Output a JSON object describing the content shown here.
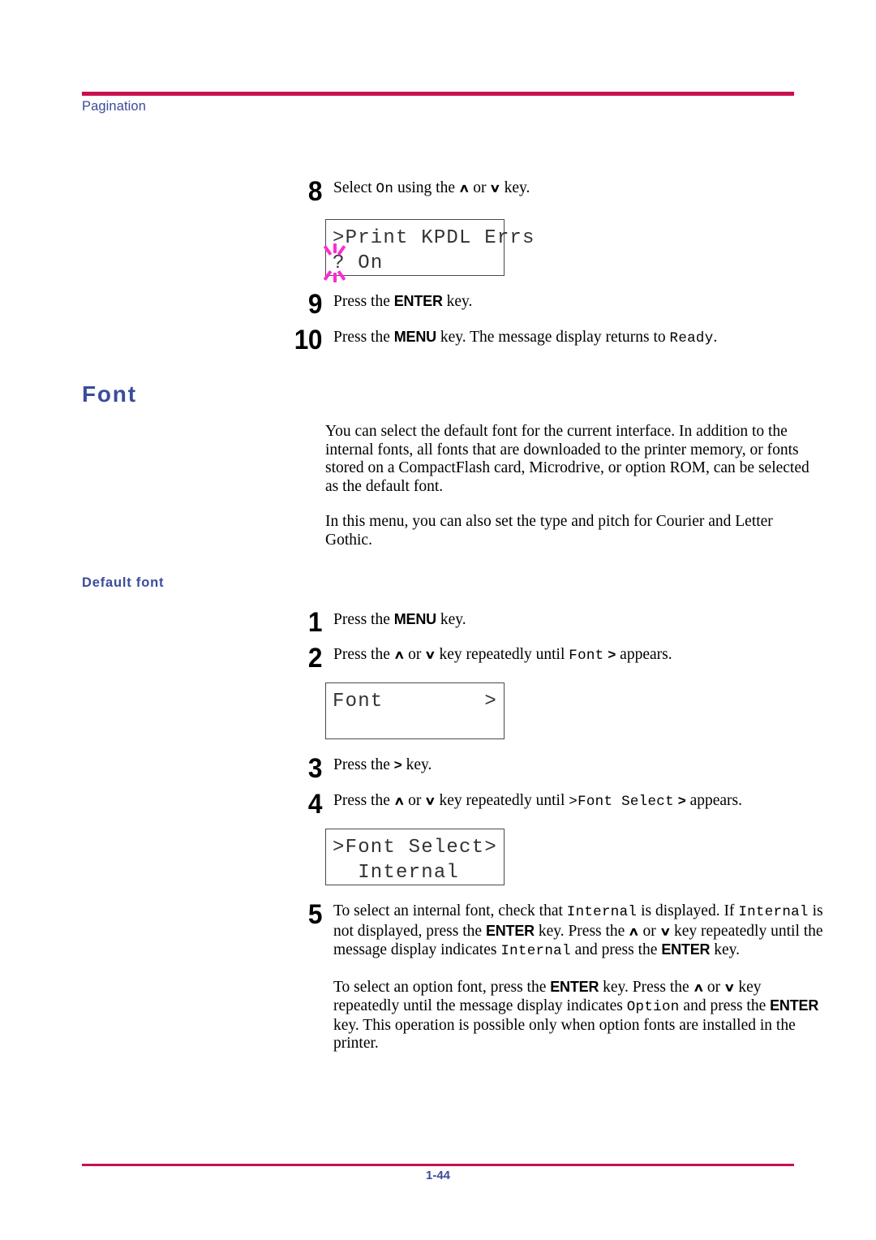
{
  "header": {
    "section_label": "Pagination"
  },
  "footer": {
    "page_number": "1-44"
  },
  "headings": {
    "font": "Font",
    "default_font": "Default font"
  },
  "steps_pagination": [
    {
      "num": "8",
      "prefix": "Select ",
      "mono1": "On",
      "mid": " using the ",
      "up": "∧",
      "or": " or ",
      "down": "∨",
      "suffix": " key."
    },
    {
      "num": "9",
      "prefix": "Press the ",
      "key": "ENTER",
      "suffix": " key."
    },
    {
      "num": "10",
      "prefix": "Press the ",
      "key": "MENU",
      "mid": " key. The message display returns to ",
      "mono1": "Ready",
      "suffix": "."
    }
  ],
  "lcd_kpdl": {
    "line1": ">Print KPDL Errs",
    "line2_cursor": "?",
    "line2_rest": " On",
    "blinking": true
  },
  "intro": {
    "p1": "You can select the default font for the current interface. In addition to the internal fonts, all fonts that are downloaded to the printer memory, or fonts stored on a CompactFlash card, Microdrive, or option ROM, can be selected as the default font.",
    "p2": "In this menu, you can also set the type and pitch for Courier and Letter Gothic."
  },
  "steps_default_font": {
    "s1": {
      "num": "1",
      "prefix": "Press the ",
      "key": "MENU",
      "suffix": " key."
    },
    "s2": {
      "num": "2",
      "prefix": "Press the ",
      "up": "∧",
      "or": " or ",
      "down": "∨",
      "mid": " key repeatedly until ",
      "mono1": "Font",
      "gt": ">",
      "suffix": " appears."
    },
    "s3": {
      "num": "3",
      "prefix": "Press the ",
      "gt": ">",
      "suffix": " key."
    },
    "s4": {
      "num": "4",
      "prefix": "Press the ",
      "up": "∧",
      "or": " or ",
      "down": "∨",
      "mid": " key repeatedly until ",
      "mono1": ">Font Select",
      "gt": ">",
      "suffix": " appears."
    },
    "s5": {
      "num": "5",
      "p1_a": "To select an internal font, check that ",
      "p1_mono1": "Internal",
      "p1_b": " is displayed. If ",
      "p1_mono2": "Internal",
      "p1_c": " is not displayed, press the ",
      "p1_key1": "ENTER",
      "p1_d": " key. Press the ",
      "p1_up": "∧",
      "p1_or": " or ",
      "p1_down": "∨",
      "p1_e": " key repeatedly until the message display indicates ",
      "p1_mono3": "Internal",
      "p1_f": " and press the ",
      "p1_key2": "ENTER",
      "p1_g": " key.",
      "p2_a": "To select an option font, press the ",
      "p2_key1": "ENTER",
      "p2_b": " key. Press the ",
      "p2_up": "∧",
      "p2_or": " or ",
      "p2_down": "∨",
      "p2_c": " key repeatedly until the message display indicates ",
      "p2_mono1": "Option",
      "p2_d": " and press the ",
      "p2_key2": "ENTER",
      "p2_e": " key. This operation is possible only when option fonts are installed in the printer."
    }
  },
  "lcd_font": {
    "line1_left": "Font",
    "line1_right": ">",
    "line2": ""
  },
  "lcd_font_select": {
    "line1_left": ">Font Select",
    "line1_right": ">",
    "line2": "  Internal"
  },
  "colors": {
    "rule": "#C8104E",
    "heading": "#3B4C9B",
    "blink": "#FF2BD1"
  }
}
